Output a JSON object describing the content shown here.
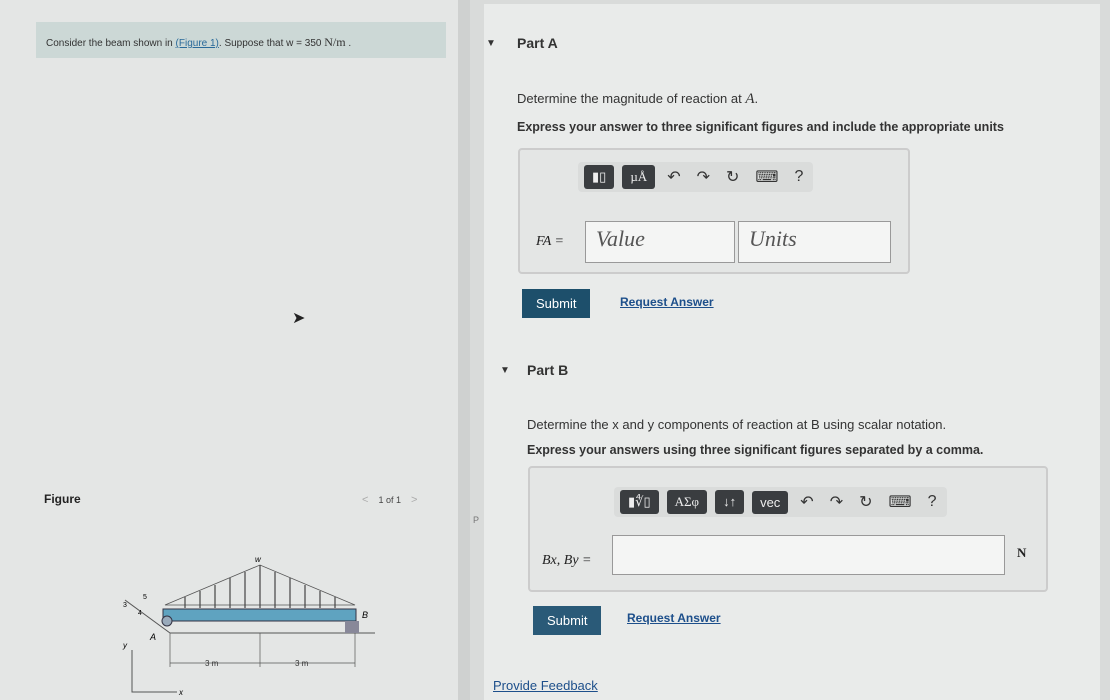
{
  "problem": {
    "prefix": "Consider the beam shown in ",
    "link": "(Figure 1)",
    "middle": ". Suppose that w = 350 ",
    "unit": "N/m",
    "suffix": " ."
  },
  "figure": {
    "label": "Figure",
    "pager": "1 of 1",
    "prev": "<",
    "next": ">",
    "load_label": "w",
    "point_a": "A",
    "point_b": "B",
    "dim1": "3 m",
    "dim2": "3 m",
    "slope_rise": "3",
    "slope_hyp": "5",
    "slope_run": "4",
    "axis_x": "x",
    "axis_y": "y"
  },
  "side_stub": "P",
  "partA": {
    "title": "Part A",
    "question_prefix": "Determine the magnitude of reaction at ",
    "question_var": "A",
    "question_suffix": ".",
    "instruction": "Express your answer to three significant figures and include the appropriate units",
    "toolbar": [
      "templates-button",
      "µÅ"
    ],
    "label": "FA =",
    "value_placeholder": "Value",
    "units_placeholder": "Units",
    "submit": "Submit",
    "request": "Request Answer"
  },
  "partB": {
    "title": "Part B",
    "question": "Determine the x and y components of reaction at B using scalar notation.",
    "instruction": "Express your answers using three significant figures separated by a comma.",
    "toolbar": [
      "ΑΣφ",
      "↓↑",
      "vec"
    ],
    "label": "Bx, By =",
    "unit": "N",
    "submit": "Submit",
    "request": "Request Answer"
  },
  "feedback": "Provide Feedback",
  "icons": {
    "undo": "↶",
    "redo": "↷",
    "reset": "↻",
    "keyboard": "⌨",
    "help": "?"
  }
}
